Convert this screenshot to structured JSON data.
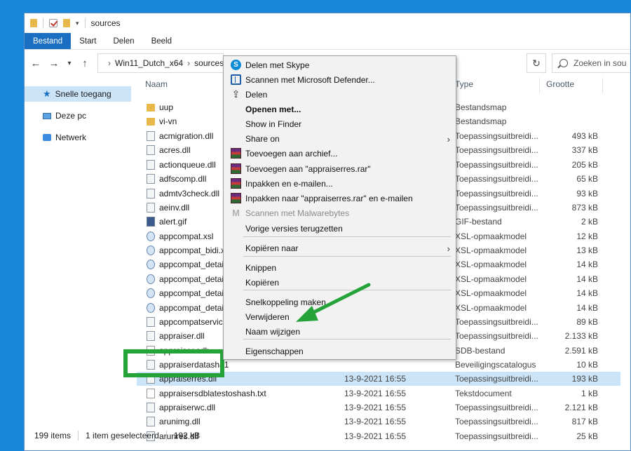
{
  "window": {
    "title": "sources"
  },
  "ribbon": {
    "tabs": [
      "Bestand",
      "Start",
      "Delen",
      "Beeld"
    ]
  },
  "address": {
    "path_1": "Win11_Dutch_x64",
    "path_2": "sources",
    "search_placeholder": "Zoeken in sou"
  },
  "nav": {
    "items": [
      "Snelle toegang",
      "Deze pc",
      "Netwerk"
    ]
  },
  "columns": {
    "name": "Naam",
    "type": "Type",
    "size": "Grootte"
  },
  "files": [
    {
      "name": "uup",
      "date": "",
      "type": "Bestandsmap",
      "size": "",
      "icon": "folder"
    },
    {
      "name": "vi-vn",
      "date": "",
      "type": "Bestandsmap",
      "size": "",
      "icon": "folder"
    },
    {
      "name": "acmigration.dll",
      "date": "",
      "type": "Toepassingsuitbreidi...",
      "size": "493 kB",
      "icon": "dll"
    },
    {
      "name": "acres.dll",
      "date": "",
      "type": "Toepassingsuitbreidi...",
      "size": "337 kB",
      "icon": "dll"
    },
    {
      "name": "actionqueue.dll",
      "date": "",
      "type": "Toepassingsuitbreidi...",
      "size": "205 kB",
      "icon": "dll"
    },
    {
      "name": "adfscomp.dll",
      "date": "",
      "type": "Toepassingsuitbreidi...",
      "size": "65 kB",
      "icon": "dll"
    },
    {
      "name": "admtv3check.dll",
      "date": "",
      "type": "Toepassingsuitbreidi...",
      "size": "93 kB",
      "icon": "dll"
    },
    {
      "name": "aeinv.dll",
      "date": "",
      "type": "Toepassingsuitbreidi...",
      "size": "873 kB",
      "icon": "dll"
    },
    {
      "name": "alert.gif",
      "date": "",
      "type": "GIF-bestand",
      "size": "2 kB",
      "icon": "gif"
    },
    {
      "name": "appcompat.xsl",
      "date": "",
      "type": "XSL-opmaakmodel",
      "size": "12 kB",
      "icon": "xsl"
    },
    {
      "name": "appcompat_bidi.x",
      "date": "",
      "type": "XSL-opmaakmodel",
      "size": "13 kB",
      "icon": "xsl"
    },
    {
      "name": "appcompat_detail",
      "date": "",
      "type": "XSL-opmaakmodel",
      "size": "14 kB",
      "icon": "xsl"
    },
    {
      "name": "appcompat_detail",
      "date": "",
      "type": "XSL-opmaakmodel",
      "size": "14 kB",
      "icon": "xsl"
    },
    {
      "name": "appcompat_detail",
      "date": "",
      "type": "XSL-opmaakmodel",
      "size": "14 kB",
      "icon": "xsl"
    },
    {
      "name": "appcompat_detail",
      "date": "",
      "type": "XSL-opmaakmodel",
      "size": "14 kB",
      "icon": "xsl"
    },
    {
      "name": "appcompatservici",
      "date": "",
      "type": "Toepassingsuitbreidi...",
      "size": "89 kB",
      "icon": "dll"
    },
    {
      "name": "appraiser.dll",
      "date": "",
      "type": "Toepassingsuitbreidi...",
      "size": "2.133 kB",
      "icon": "dll"
    },
    {
      "name": "appraiser.sdb",
      "date": "",
      "type": "SDB-bestand",
      "size": "2.591 kB",
      "icon": "txt"
    },
    {
      "name": "appraiserdatasha1",
      "date": "",
      "type": "Beveiligingscatalogus",
      "size": "10 kB",
      "icon": "dll"
    },
    {
      "name": "appraiserres.dll",
      "date": "13-9-2021 16:55",
      "type": "Toepassingsuitbreidi...",
      "size": "193 kB",
      "icon": "dll",
      "selected": true
    },
    {
      "name": "appraisersdblatestoshash.txt",
      "date": "13-9-2021 16:55",
      "type": "Tekstdocument",
      "size": "1 kB",
      "icon": "txt"
    },
    {
      "name": "appraiserwc.dll",
      "date": "13-9-2021 16:55",
      "type": "Toepassingsuitbreidi...",
      "size": "2.121 kB",
      "icon": "dll"
    },
    {
      "name": "arunimg.dll",
      "date": "13-9-2021 16:55",
      "type": "Toepassingsuitbreidi...",
      "size": "817 kB",
      "icon": "dll"
    },
    {
      "name": "arunres.dll",
      "date": "13-9-2021 16:55",
      "type": "Toepassingsuitbreidi...",
      "size": "25 kB",
      "icon": "dll"
    }
  ],
  "status": {
    "count": "199 items",
    "selected": "1 item geselecteerd",
    "size": "192 kB"
  },
  "context_menu": [
    {
      "label": "Delen met Skype",
      "icon": "skype-icon"
    },
    {
      "label": "Scannen met Microsoft Defender...",
      "icon": "defender-icon"
    },
    {
      "label": "Delen",
      "icon": "share-icon"
    },
    {
      "label": "Openen met...",
      "bold": true
    },
    {
      "label": "Show in Finder"
    },
    {
      "label": "Share on",
      "submenu": true
    },
    {
      "label": "Toevoegen aan archief...",
      "icon": "winrar-icon"
    },
    {
      "label": "Toevoegen aan \"appraiserres.rar\"",
      "icon": "winrar-icon"
    },
    {
      "label": "Inpakken en e-mailen...",
      "icon": "winrar-icon"
    },
    {
      "label": "Inpakken naar \"appraiserres.rar\" en e-mailen",
      "icon": "winrar-icon"
    },
    {
      "label": "Scannen met Malwarebytes",
      "icon": "malwarebytes-icon",
      "disabled": true
    },
    {
      "label": "Vorige versies terugzetten"
    },
    {
      "label": "Kopiëren naar",
      "submenu": true
    },
    {
      "label": "Knippen"
    },
    {
      "label": "Kopiëren"
    },
    {
      "label": "Snelkoppeling maken"
    },
    {
      "label": "Verwijderen"
    },
    {
      "label": "Naam wijzigen"
    },
    {
      "label": "Eigenschappen"
    }
  ],
  "colors": {
    "accent": "#1a6fc2",
    "highlight": "#25a339",
    "selection": "#cce4f7"
  }
}
